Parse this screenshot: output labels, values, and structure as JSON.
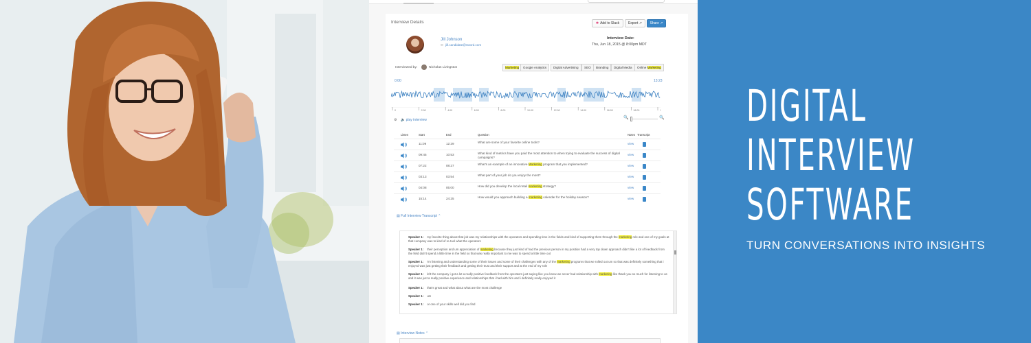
{
  "hero": {
    "title_lines": [
      "DIGITAL",
      "INTERVIEW",
      "SOFTWARE"
    ],
    "tagline": "TURN CONVERSATIONS INTO INSIGHTS",
    "background_color": "#3b87c6"
  },
  "app": {
    "section_title": "Interview Details",
    "buttons": {
      "add_to_slack": "Add to Slack",
      "export": "Export",
      "share": "Share"
    },
    "interviewee": {
      "name": "Jill Johnson",
      "email": "jill.candidate@sword.com"
    },
    "interview_date": {
      "label": "Interview Date:",
      "value": "Thu, Jun 18, 2015 @ 8:00pm MDT"
    },
    "interviewed_by": {
      "label": "Interviewed by:",
      "name": "Nicholas Livingston"
    },
    "tags": [
      {
        "text": "Marketing",
        "highlight": true
      },
      {
        "text": "Google Analytics",
        "highlight": false
      },
      {
        "text": "Digital Advertising",
        "highlight": false
      },
      {
        "text": "SEO",
        "highlight": false
      },
      {
        "text": "Branding",
        "highlight": false
      },
      {
        "text": "Digital Media",
        "highlight": false
      },
      {
        "text": "Online",
        "highlight": false,
        "suffix": "Marketing"
      }
    ],
    "audio": {
      "start": "0:00",
      "end": "13:23",
      "play_label": "play interview",
      "ruler_ticks": [
        "0",
        "2:00",
        "4:00",
        "6:00",
        "8:00",
        "10:00",
        "12:00",
        "14:00",
        "16:00",
        "18:00",
        "20:00"
      ]
    },
    "table": {
      "headers": {
        "listen": "Listen",
        "start": "Start",
        "end": "End",
        "question": "Question",
        "notes": "Notes",
        "transcript": "Transcript"
      },
      "rows": [
        {
          "start": "11:09",
          "end": "12:29",
          "q_pre": "What are some of your favorite online tools?",
          "q_hl": "",
          "q_post": "",
          "notes": "view"
        },
        {
          "start": "09:45",
          "end": "10:53",
          "q_pre": "What kind of metrics have you paid the most attention to when trying to evaluate the success of digital campaigns?",
          "q_hl": "",
          "q_post": "",
          "notes": "view"
        },
        {
          "start": "07:22",
          "end": "08:27",
          "q_pre": "What's an example of an innovative ",
          "q_hl": "Marketing",
          "q_post": " program that you implemented?",
          "notes": "view"
        },
        {
          "start": "03:13",
          "end": "03:54",
          "q_pre": "What part of your job do you enjoy the most?",
          "q_hl": "",
          "q_post": "",
          "notes": "view"
        },
        {
          "start": "04:08",
          "end": "05:00",
          "q_pre": "How did you develop the local retail ",
          "q_hl": "marketing",
          "q_post": " strategy?",
          "notes": "view"
        },
        {
          "start": "15:14",
          "end": "24:25",
          "q_pre": "How would you approach building a ",
          "q_hl": "marketing",
          "q_post": " calendar for the holiday season?",
          "notes": "view"
        }
      ]
    },
    "full_transcript_label": "Full Interview Transcript",
    "transcript": [
      {
        "speaker": "Speaker 1:",
        "pre": "my favorite thing about that job was my relationships with the operators and spending time in the fields and kind of supporting them through the ",
        "hl": "marketing",
        "post": " role and one of my goals at that company was to kind of re-tool what the operators"
      },
      {
        "speaker": "Speaker 1:",
        "pre": "their perception and um appreciation of ",
        "hl": "marketing",
        "post": " because they just kind of had the previous person in my position had a very top down approach didn't like a lot of feedback from the field didn't spend a little time in the field so that was really important to me was to spend a little time out"
      },
      {
        "speaker": "Speaker 1:",
        "pre": "I'm listening and understanding some of their issues and some of their challenges with any of the ",
        "hl": "marketing",
        "post": " programs that we rolled out um so that was definitely something that i enjoyed was just getting their feedback and getting their trust and their support and at the end of my role"
      },
      {
        "speaker": "Speaker 1:",
        "pre": "left the company i got a lot a really positive feedback from the operators just saying like you know we never had relationship with ",
        "hl": "marketing",
        "post": " like thank you so much for listening to us and it was just a really positive experience and relationships that i had with him and i definitely really enjoyed it"
      },
      {
        "speaker": "Speaker 1:",
        "pre": "that's great and what about what are the most challenge",
        "hl": "",
        "post": ""
      },
      {
        "speaker": "Speaker 1:",
        "pre": "um",
        "hl": "",
        "post": ""
      },
      {
        "speaker": "Speaker 1:",
        "pre": "or one of your skills well did you find",
        "hl": "",
        "post": ""
      }
    ],
    "interview_notes_label": "Interview Notes"
  }
}
